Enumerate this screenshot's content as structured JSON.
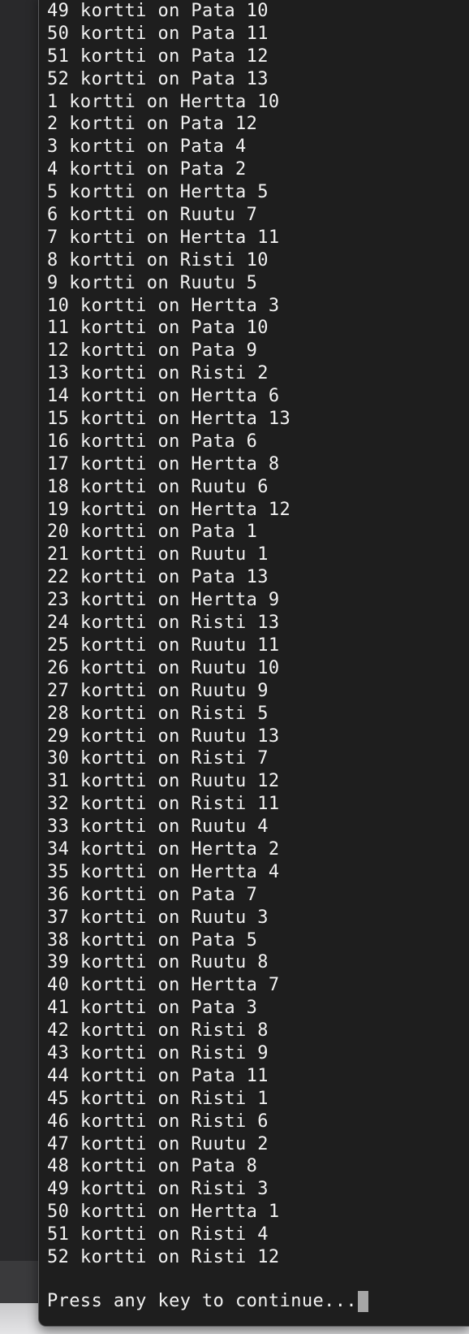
{
  "terminal": {
    "lines": [
      "49 kortti on Pata 10",
      "50 kortti on Pata 11",
      "51 kortti on Pata 12",
      "52 kortti on Pata 13",
      "1 kortti on Hertta 10",
      "2 kortti on Pata 12",
      "3 kortti on Pata 4",
      "4 kortti on Pata 2",
      "5 kortti on Hertta 5",
      "6 kortti on Ruutu 7",
      "7 kortti on Hertta 11",
      "8 kortti on Risti 10",
      "9 kortti on Ruutu 5",
      "10 kortti on Hertta 3",
      "11 kortti on Pata 10",
      "12 kortti on Pata 9",
      "13 kortti on Risti 2",
      "14 kortti on Hertta 6",
      "15 kortti on Hertta 13",
      "16 kortti on Pata 6",
      "17 kortti on Hertta 8",
      "18 kortti on Ruutu 6",
      "19 kortti on Hertta 12",
      "20 kortti on Pata 1",
      "21 kortti on Ruutu 1",
      "22 kortti on Pata 13",
      "23 kortti on Hertta 9",
      "24 kortti on Risti 13",
      "25 kortti on Ruutu 11",
      "26 kortti on Ruutu 10",
      "27 kortti on Ruutu 9",
      "28 kortti on Risti 5",
      "29 kortti on Ruutu 13",
      "30 kortti on Risti 7",
      "31 kortti on Ruutu 12",
      "32 kortti on Risti 11",
      "33 kortti on Ruutu 4",
      "34 kortti on Hertta 2",
      "35 kortti on Hertta 4",
      "36 kortti on Pata 7",
      "37 kortti on Ruutu 3",
      "38 kortti on Pata 5",
      "39 kortti on Ruutu 8",
      "40 kortti on Hertta 7",
      "41 kortti on Pata 3",
      "42 kortti on Risti 8",
      "43 kortti on Risti 9",
      "44 kortti on Pata 11",
      "45 kortti on Risti 1",
      "46 kortti on Risti 6",
      "47 kortti on Ruutu 2",
      "48 kortti on Pata 8",
      "49 kortti on Risti 3",
      "50 kortti on Hertta 1",
      "51 kortti on Risti 4",
      "52 kortti on Risti 12"
    ],
    "prompt": "Press any key to continue...",
    "colors": {
      "background": "#1e1e1e",
      "text": "#f2f2f2",
      "cursor": "#a6a6a6"
    }
  }
}
